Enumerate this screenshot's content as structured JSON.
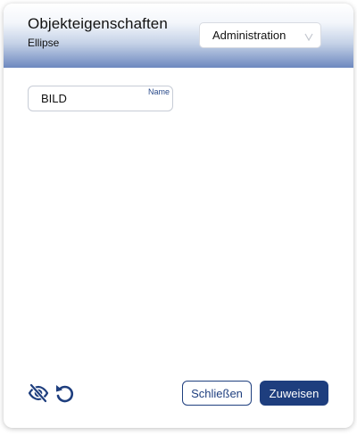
{
  "header": {
    "title": "Objekteigenschaften",
    "subtitle": "Ellipse"
  },
  "role_select": {
    "selected": "Administration",
    "icon": "chevron-down-icon"
  },
  "name_field": {
    "label": "Name",
    "value": "BILD"
  },
  "footer": {
    "hide_icon": "eye-off-icon",
    "reset_icon": "undo-icon",
    "close_label": "Schließen",
    "assign_label": "Zuweisen"
  },
  "colors": {
    "primary": "#1e3e7e",
    "header_gradient_end": "#6d88bf",
    "label": "#2a4a8a"
  }
}
